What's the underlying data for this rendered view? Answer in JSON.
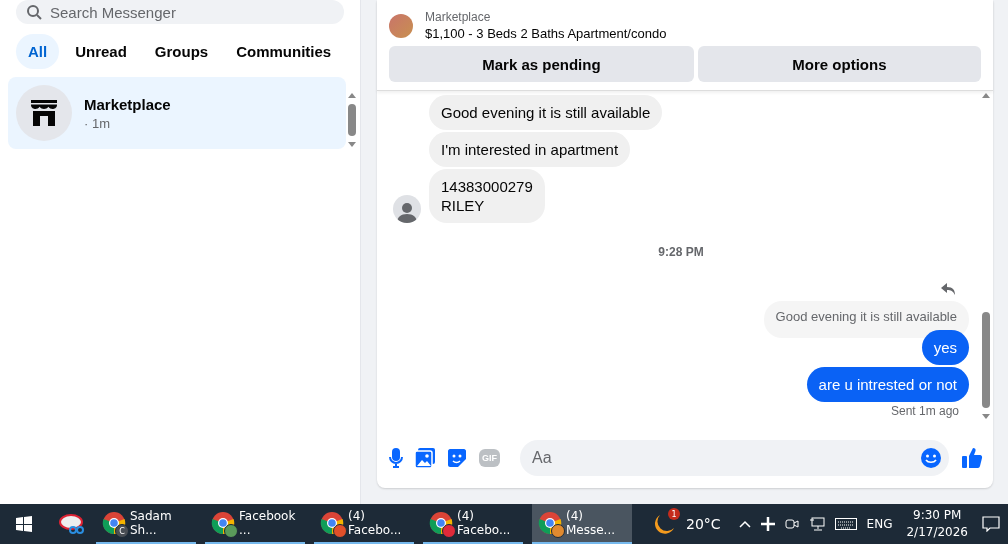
{
  "sidebar": {
    "search": {
      "placeholder": "Search Messenger"
    },
    "filters": [
      {
        "label": "All",
        "selected": true
      },
      {
        "label": "Unread",
        "selected": false
      },
      {
        "label": "Groups",
        "selected": false
      },
      {
        "label": "Communities",
        "selected": false
      }
    ],
    "conversations": [
      {
        "name": "Marketplace",
        "time": "· 1m",
        "selected": true
      }
    ]
  },
  "chat": {
    "listing": {
      "source": "Marketplace",
      "title": "$1,100 - 3 Beds 2 Baths Apartment/condo"
    },
    "buttons": [
      "Mark as pending",
      "More options"
    ],
    "messages": [
      {
        "kind": "incoming",
        "text": "Good evening it is still available"
      },
      {
        "kind": "incoming",
        "text": "I'm interested in apartment"
      },
      {
        "kind": "incoming",
        "text": "14383000279\nRILEY",
        "avatar": true
      },
      {
        "kind": "time",
        "text": "9:28 PM"
      },
      {
        "kind": "reply",
        "text": "Good evening it is still available"
      },
      {
        "kind": "outgoing",
        "text": "yes"
      },
      {
        "kind": "outgoing",
        "text": "are u intrested or not"
      },
      {
        "kind": "status",
        "text": "Sent 1m ago"
      }
    ],
    "composer": {
      "gif_label": "GIF",
      "placeholder": "Aa"
    }
  },
  "taskbar": {
    "apps": [
      {
        "label": "Sadam Sh...",
        "badge": "C",
        "color": "#4a4f55",
        "selected": false
      },
      {
        "label": "Facebook ...",
        "color": "#5a9a5a",
        "selected": false
      },
      {
        "label": "(4) Facebo...",
        "color": "#e0502a",
        "selected": false
      },
      {
        "label": "(4) Facebo...",
        "color": "#e02a3a",
        "selected": false
      },
      {
        "label": "(4) Messe...",
        "color": "#e08a30",
        "selected": true
      }
    ],
    "weather": {
      "badge": "1",
      "temp": "20°C"
    },
    "lang": "ENG",
    "time": "9:30 PM",
    "date": "2/17/2026"
  }
}
